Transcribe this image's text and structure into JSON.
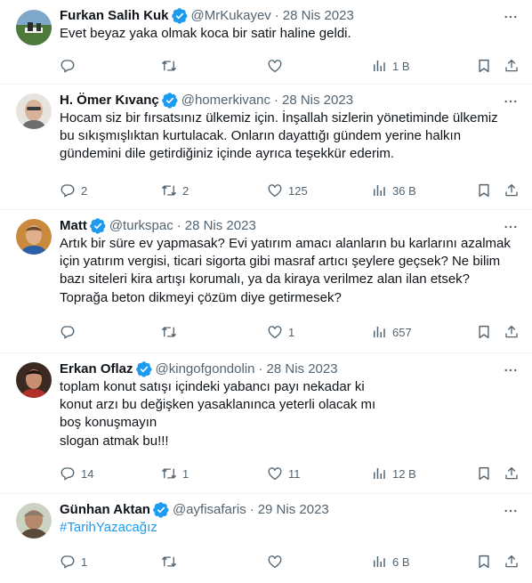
{
  "tweets": [
    {
      "name": "Furkan Salih Kuk",
      "handle": "@MrKukayev",
      "date": "28 Nis 2023",
      "lines": [
        "Evet beyaz yaka olmak koca bir satir haline geldi."
      ],
      "replies": "",
      "retweets": "",
      "likes": "",
      "views": "1 B"
    },
    {
      "name": "H. Ömer Kıvanç",
      "handle": "@homerkivanc",
      "date": "28 Nis 2023",
      "lines": [
        "Hocam siz bir fırsatsınız ülkemiz için. İnşallah sizlerin yönetiminde ülkemiz",
        "bu sıkışmışlıktan kurtulacak. Onların dayattığı gündem yerine halkın",
        "gündemini dile getirdiğiniz içinde ayrıca teşekkür ederim."
      ],
      "replies": "2",
      "retweets": "2",
      "likes": "125",
      "views": "36 B"
    },
    {
      "name": "Matt",
      "handle": "@turkspac",
      "date": "28 Nis 2023",
      "lines": [
        "Artık bir süre ev yapmasak?  Evi yatırım amacı alanların bu karlarını azalmak",
        "için yatırım vergisi, ticari sigorta gibi masraf artıcı şeylere geçsek? Ne bilim",
        "bazı siteleri kira artışı korumalı, ya da kiraya verilmez  alan ilan etsek?",
        "Toprağa beton dikmeyi çözüm diye getirmesek?"
      ],
      "replies": "",
      "retweets": "",
      "likes": "1",
      "views": "657"
    },
    {
      "name": "Erkan Oflaz",
      "handle": "@kingofgondolin",
      "date": "28 Nis 2023",
      "lines": [
        "toplam konut satışı içindeki yabancı payı nekadar ki",
        "konut arzı bu değişken yasaklanınca yeterli olacak mı",
        "boş konuşmayın",
        "slogan atmak bu!!!"
      ],
      "replies": "14",
      "retweets": "1",
      "likes": "11",
      "views": "12 B"
    },
    {
      "name": "Günhan Aktan",
      "handle": "@ayfisafaris",
      "date": "29 Nis 2023",
      "lines": [
        "#TarihYazacağız"
      ],
      "replies": "1",
      "retweets": "",
      "likes": "",
      "views": "6 B"
    }
  ],
  "colors": {
    "text": "#0f1419",
    "secondary": "#536471",
    "verified": "#1d9bf0",
    "hashtag": "#1d9bf0",
    "divider": "#eff3f4"
  },
  "icons": [
    "verified-badge-icon",
    "more-icon",
    "reply-icon",
    "retweet-icon",
    "like-icon",
    "views-icon",
    "bookmark-icon",
    "share-icon"
  ]
}
